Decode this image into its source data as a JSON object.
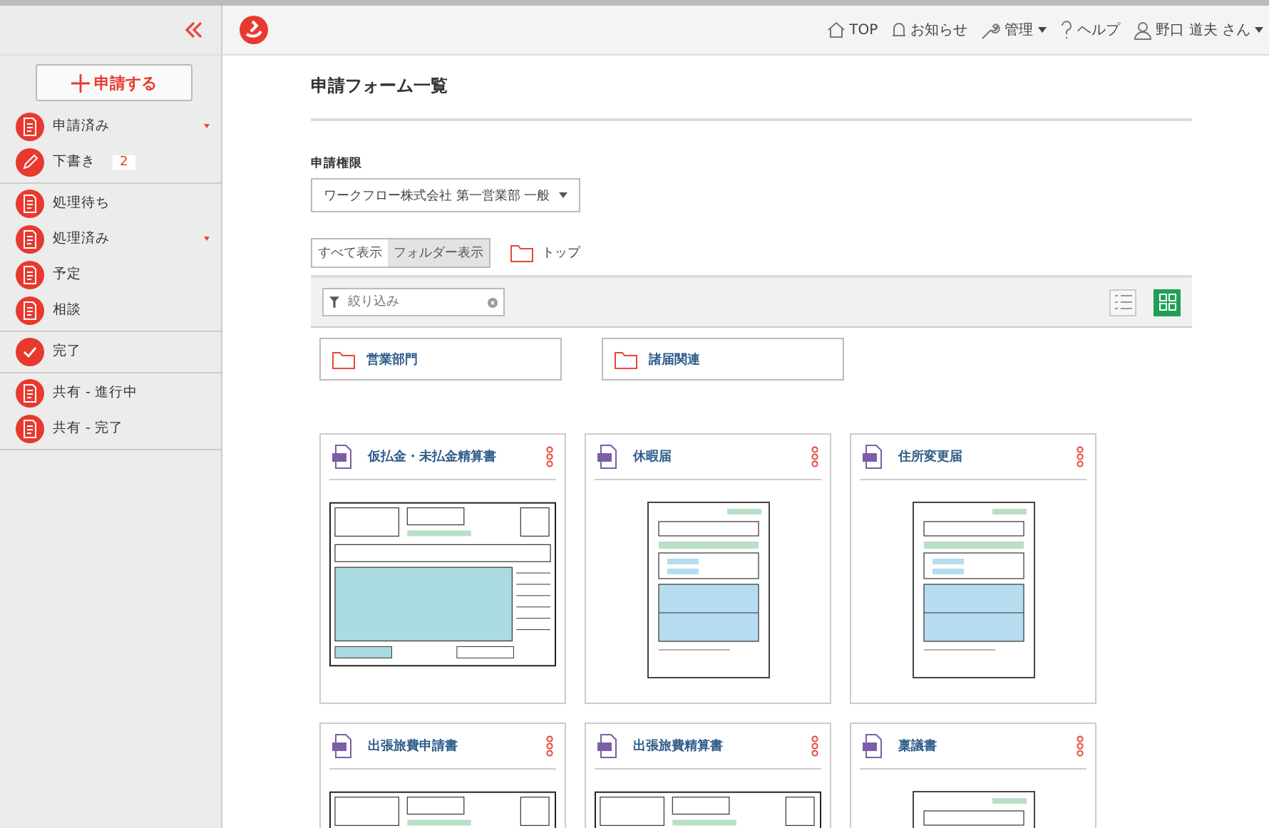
{
  "nav": [
    {
      "label": "TOP",
      "dropdown": false
    },
    {
      "label": "お知らせ",
      "dropdown": false
    },
    {
      "label": "管理",
      "dropdown": true
    },
    {
      "label": "ヘルプ",
      "dropdown": false
    },
    {
      "label": "野口 道夫 さん",
      "dropdown": true
    }
  ],
  "sidebar": {
    "new_button": "申請する",
    "groups": [
      {
        "items": [
          {
            "label": "申請済み",
            "expandable": true
          },
          {
            "label": "下書き",
            "badge": "2",
            "expandable": false
          }
        ]
      },
      {
        "items": [
          {
            "label": "処理待ち",
            "expandable": false
          },
          {
            "label": "処理済み",
            "expandable": true
          },
          {
            "label": "予定",
            "expandable": false
          },
          {
            "label": "相談",
            "expandable": false
          }
        ]
      },
      {
        "items": [
          {
            "label": "完了",
            "expandable": false
          }
        ]
      },
      {
        "items": [
          {
            "label": "共有 - 進行中",
            "expandable": false
          },
          {
            "label": "共有 - 完了",
            "expandable": false
          }
        ]
      }
    ]
  },
  "page_title": "申請フォーム一覧",
  "permission": {
    "label": "申請権限",
    "value": "ワークフロー株式会社 第一営業部 一般"
  },
  "view_tabs": [
    {
      "label": "すべて表示",
      "selected": false
    },
    {
      "label": "フォルダー表示",
      "selected": true
    }
  ],
  "breadcrumb": "トップ",
  "filter": {
    "placeholder": "絞り込み"
  },
  "layout_buttons": [
    {
      "kind": "list",
      "selected": false
    },
    {
      "kind": "grid",
      "selected": true
    }
  ],
  "folders": [
    "営業部門",
    "諸届関連"
  ],
  "forms": [
    {
      "title": "仮払金・未払金精算書",
      "kind": "landscape"
    },
    {
      "title": "休暇届",
      "kind": "portrait"
    },
    {
      "title": "住所変更届",
      "kind": "portrait"
    },
    {
      "title": "出張旅費申請書",
      "kind": "landscape"
    },
    {
      "title": "出張旅費精算書",
      "kind": "landscape"
    },
    {
      "title": "稟議書",
      "kind": "portrait"
    }
  ]
}
